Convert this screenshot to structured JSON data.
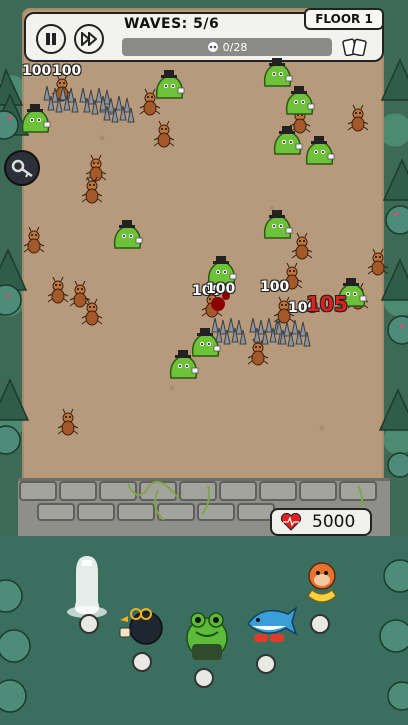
{
  "hud": {
    "waves_label": "WAVES: 5/6",
    "floor_label": "FLOOR 1",
    "kills_progress": "0/28",
    "kills_fraction": 0
  },
  "base": {
    "hp_value": "5000"
  },
  "damage_popups": [
    "100",
    "100",
    "100",
    "100",
    "100",
    "100",
    "105"
  ],
  "colors": {
    "ground": "#b79a7b",
    "forest": "#3d6a56",
    "slime": "#6ec23a",
    "ant": "#b5612b",
    "damage_red": "#e0201c"
  },
  "heroes": [
    {
      "name": "ghost-hero-icon"
    },
    {
      "name": "crow-hero-icon"
    },
    {
      "name": "frog-hero-icon"
    },
    {
      "name": "shark-hero-icon"
    },
    {
      "name": "monkey-hero-icon"
    }
  ]
}
